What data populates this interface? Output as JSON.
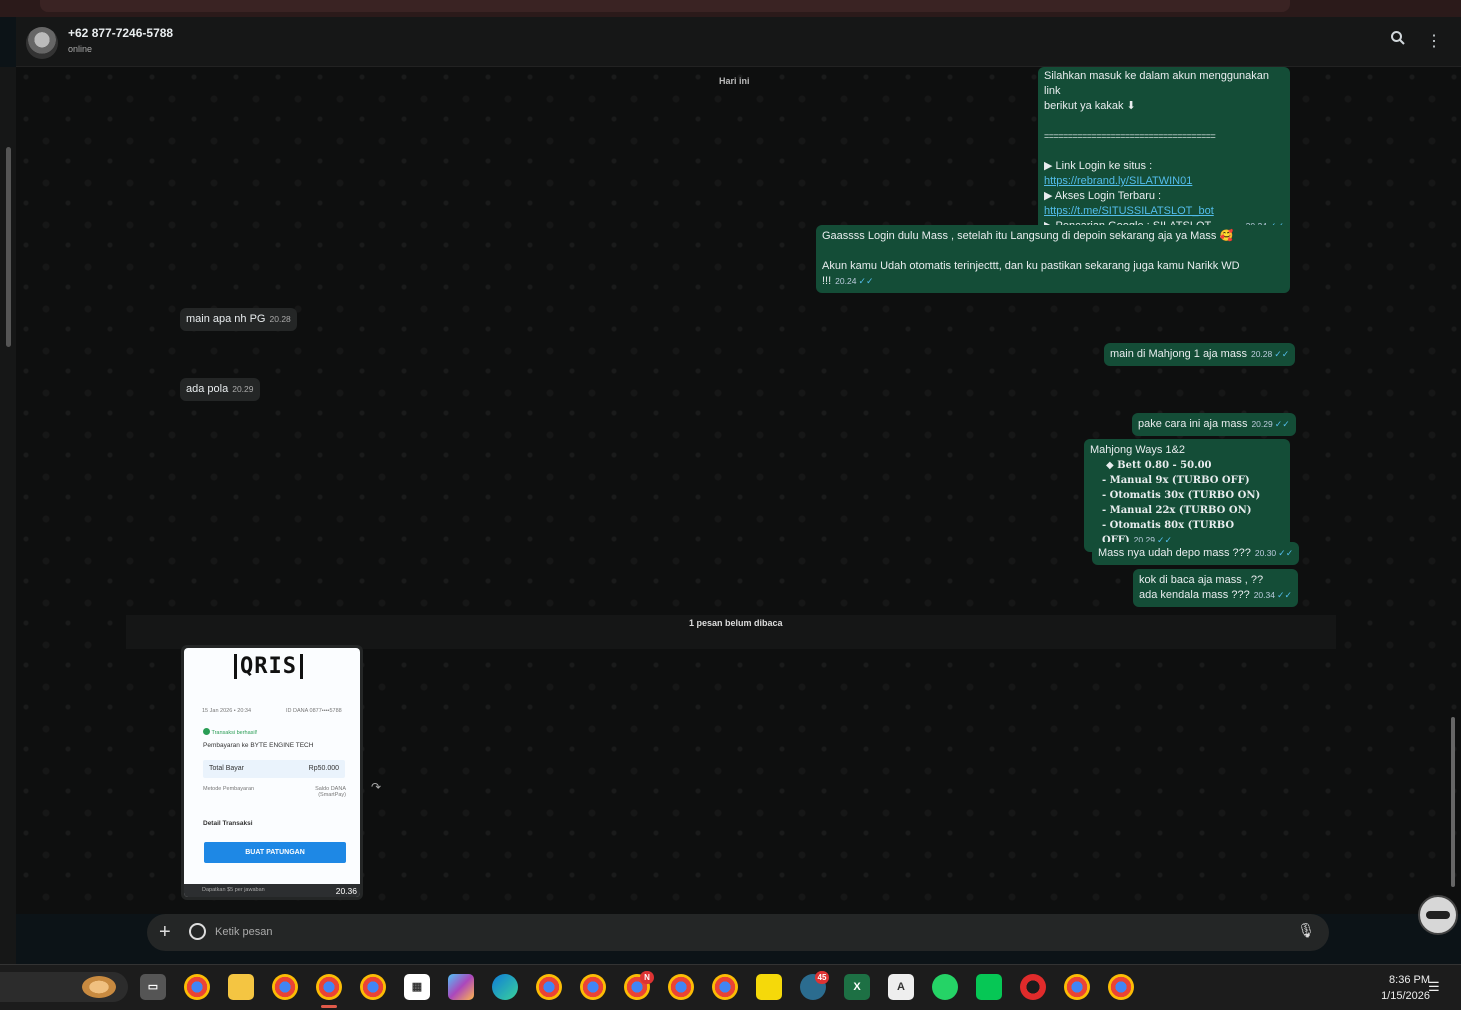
{
  "header": {
    "contact_name": "+62 877-7246-5788",
    "status": "online"
  },
  "chat": {
    "date_chip": "Hari ini",
    "messages": [
      {
        "dir": "out",
        "lines": [
          "Silahkan masuk ke dalam akun menggunakan link",
          "berikut ya kakak ⬇",
          "",
          "====================================",
          "",
          "▶ Link Login ke situs  :",
          "https://rebrand.ly/SILATWIN01",
          "▶ Akses Login Terbaru :",
          "https://t.me/SITUSSILATSLOT_bot",
          "▶ Pencarian Google : SILATSLOT"
        ],
        "time": "20.24"
      },
      {
        "dir": "out",
        "lines": [
          "Gaassss Login dulu Mass  , setelah itu Langsung di depoin sekarang aja ya Mass 🥰",
          "",
          "Akun kamu Udah otomatis terinjecttt, dan ku pastikan sekarang juga kamu Narikk WD !!!"
        ],
        "time": "20.24"
      },
      {
        "dir": "in",
        "text": "main apa nh PG",
        "time": "20.28"
      },
      {
        "dir": "out",
        "text": "main di Mahjong 1 aja mass",
        "time": "20.28"
      },
      {
        "dir": "in",
        "text": "ada pola",
        "time": "20.29"
      },
      {
        "dir": "out",
        "text": "pake cara ini aja mass",
        "time": "20.29"
      },
      {
        "dir": "out",
        "title": "Mahjong Ways 1&2",
        "lines": [
          "◆ 𝐁𝐞𝐭𝐭 0.80 - 50.00",
          "- 𝐌𝐚𝐧𝐮𝐚𝐥    9x (TURBO OFF)",
          "- 𝐎𝐭𝐨𝐦𝐚𝐭𝐢𝐬 30x (TURBO ON)",
          "- 𝐌𝐚𝐧𝐮𝐚𝐥   22x (TURBO ON)",
          "- 𝐎𝐭𝐨𝐦𝐚𝐭𝐢𝐬 80x (TURBO OFF)"
        ],
        "time": "20.29"
      },
      {
        "dir": "out",
        "text": "Mass nya udah depo mass ???",
        "time": "20.30"
      },
      {
        "dir": "out",
        "lines": [
          "kok di baca aja mass , ??",
          "ada kendala mass ???"
        ],
        "time": "20.34"
      }
    ],
    "unread_label": "1 pesan belum dibaca",
    "image_message": {
      "time": "20.36",
      "receipt": {
        "logo": "QRIS",
        "date": "15 Jan 2026 • 20:34",
        "id": "ID DANA 0877••••5788",
        "status": "Transaksi berhasil!",
        "payee": "Pembayaran ke BYTE ENGINE TECH",
        "total_label": "Total Bayar",
        "total_value": "Rp50.000",
        "method_label": "Metode Pembayaran",
        "method_value_1": "Saldo DANA",
        "method_value_2": "(SmartPay)",
        "detail_label": "Detail Transaksi",
        "button_label": "BUAT PATUNGAN",
        "bottom_text": "Dapatkan $5 per jawaban"
      }
    }
  },
  "composer": {
    "placeholder": "Ketik pesan"
  },
  "taskbar": {
    "badges": {
      "red_n": "N",
      "count": "45"
    },
    "time": "8:36 PM",
    "date": "1/15/2026"
  },
  "colors": {
    "outgoing_bubble": "#144d37",
    "incoming_bubble": "#242626",
    "link": "#53bdeb",
    "accent_blue": "#1e88e5"
  }
}
